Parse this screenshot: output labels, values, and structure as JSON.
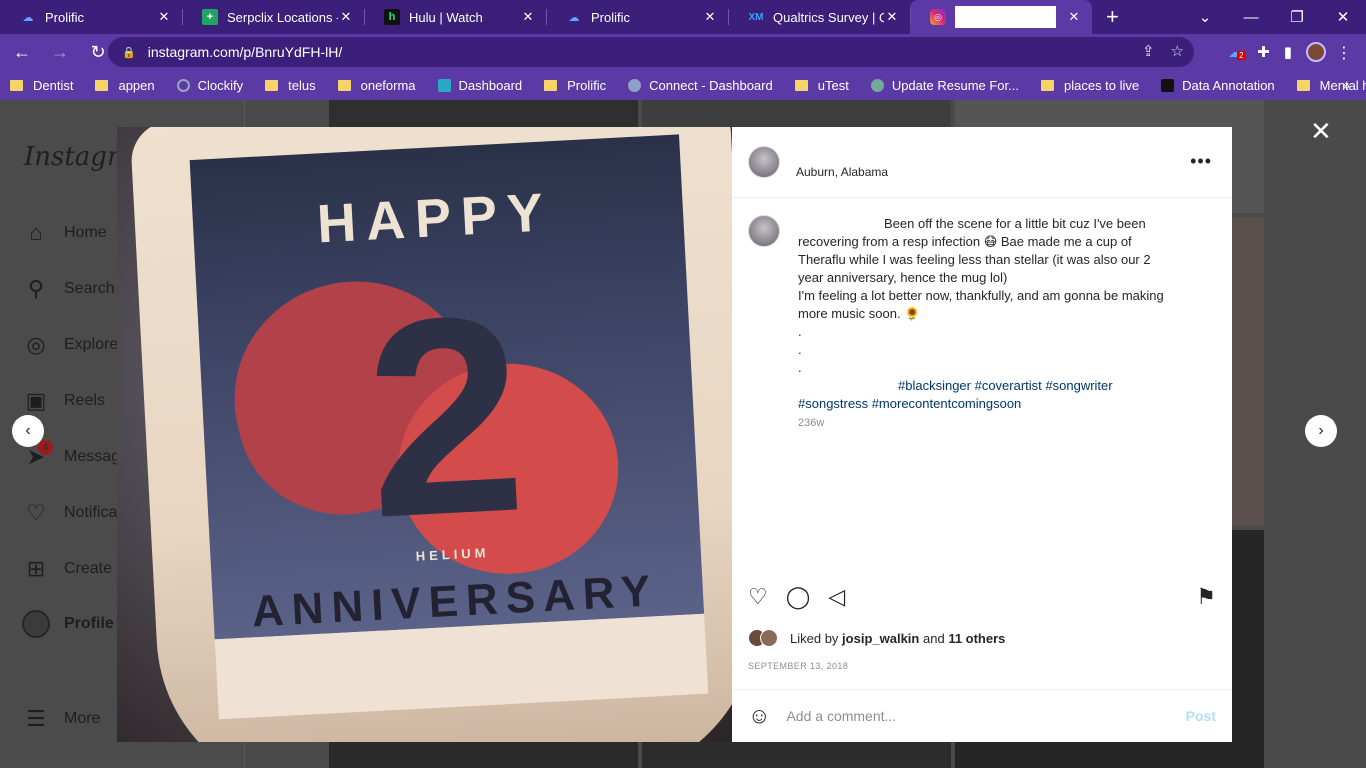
{
  "browser": {
    "tabs": [
      {
        "title": "Prolific",
        "icon": "prolific-icon",
        "active": false
      },
      {
        "title": "Serpclix Locations - Go",
        "icon": "sheets-icon",
        "active": false
      },
      {
        "title": "Hulu | Watch",
        "icon": "hulu-icon",
        "active": false
      },
      {
        "title": "Prolific",
        "icon": "prolific-icon",
        "active": false
      },
      {
        "title": "Qualtrics Survey | Qua",
        "icon": "qualtrics-icon",
        "active": false
      },
      {
        "title": "",
        "icon": "instagram-icon",
        "active": true
      }
    ],
    "url": "instagram.com/p/BnruYdFH-lH/",
    "bookmarks": [
      "Dentist",
      "appen",
      "Clockify",
      "telus",
      "oneforma",
      "Dashboard",
      "Prolific",
      "Connect - Dashboard",
      "uTest",
      "Update Resume For...",
      "places to live",
      "Data Annotation",
      "Mental health"
    ],
    "extension_badge": "2",
    "colors": {
      "tabbar": "#3b1f7a",
      "toolbar": "#5b3aa6"
    }
  },
  "sidebar": {
    "logo": "Instagram",
    "items": [
      {
        "label": "Home",
        "icon": "home-icon"
      },
      {
        "label": "Search",
        "icon": "search-icon"
      },
      {
        "label": "Explore",
        "icon": "explore-icon"
      },
      {
        "label": "Reels",
        "icon": "reels-icon"
      },
      {
        "label": "Messages",
        "icon": "messages-icon",
        "badge": "4"
      },
      {
        "label": "Notifications",
        "icon": "heart-icon"
      },
      {
        "label": "Create",
        "icon": "create-icon"
      },
      {
        "label": "Profile",
        "icon": "avatar"
      },
      {
        "label": "More",
        "icon": "menu-icon"
      }
    ]
  },
  "post": {
    "location": "Auburn, Alabama",
    "caption_lines": [
      "Been off the scene for a little bit cuz I've been",
      "recovering from a resp infection 😷 Bae made me a cup of",
      "Theraflu while I was feeling less than stellar (it was also our 2",
      "year anniversary, hence the mug lol)",
      "I'm feeling a lot better now, thankfully, and am gonna be making",
      "more music soon. 🌻",
      ".",
      ".",
      "."
    ],
    "hashtags_line1": "#blacksinger #coverartist #songwriter",
    "hashtags_line2": "#songstress #morecontentcomingsoon",
    "age": "236w",
    "liked_by_prefix": "Liked by",
    "liked_by_user": "josip_walkin",
    "liked_by_and": "and",
    "liked_by_others": "11 others",
    "date": "SEPTEMBER 13, 2018",
    "comment_placeholder": "Add a comment...",
    "post_button": "Post",
    "image_text": {
      "top": "HAPPY",
      "number": "2",
      "brand": "HELIUM",
      "bottom": "ANNIVERSARY"
    }
  }
}
